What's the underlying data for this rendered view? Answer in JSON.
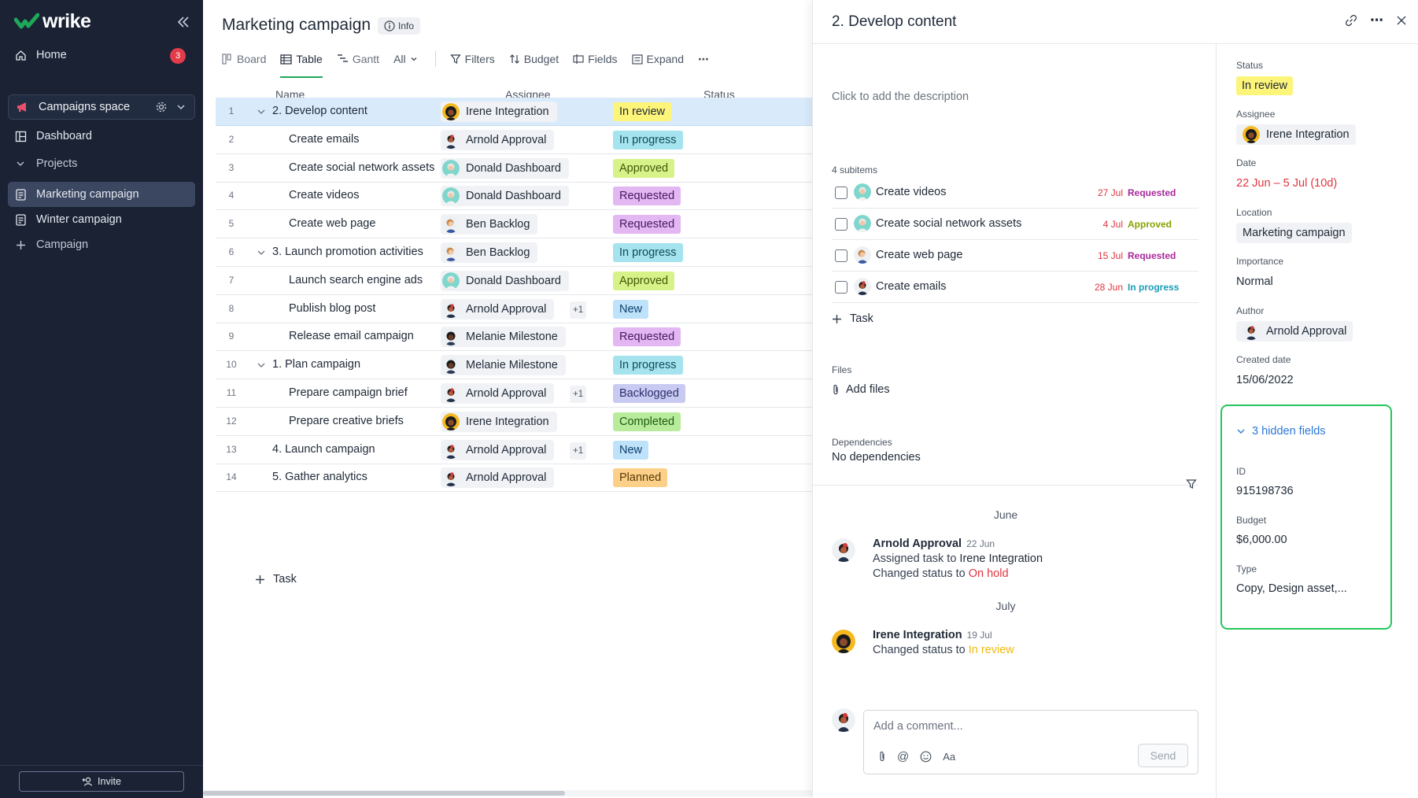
{
  "app": {
    "brand": "wrike",
    "home_label": "Home",
    "home_badge": "3",
    "space_label": "Campaigns space",
    "dashboard_label": "Dashboard",
    "projects_label": "Projects",
    "marketing_label": "Marketing campaign",
    "winter_label": "Winter campaign",
    "add_campaign_label": "Campaign",
    "invite_label": "Invite"
  },
  "colors": {
    "sidebar_bg": "#1a2234",
    "brand_green": "#1fa85a",
    "highlight_green": "#25c65a",
    "selected_row": "#d9ebfb"
  },
  "main": {
    "title": "Marketing campaign",
    "info_label": "Info",
    "toolbar": {
      "board": "Board",
      "table": "Table",
      "gantt": "Gantt",
      "all": "All",
      "filters": "Filters",
      "budget": "Budget",
      "fields": "Fields",
      "expand": "Expand"
    },
    "columns": {
      "name": "Name",
      "assignee": "Assignee",
      "status": "Status"
    },
    "rows": [
      {
        "num": "1",
        "name": "2. Develop content",
        "assignee": "Irene Integration",
        "status": "In review"
      },
      {
        "num": "2",
        "name": "Create emails",
        "assignee": "Arnold Approval",
        "status": "In progress"
      },
      {
        "num": "3",
        "name": "Create social network assets",
        "assignee": "Donald Dashboard",
        "status": "Approved"
      },
      {
        "num": "4",
        "name": "Create videos",
        "assignee": "Donald Dashboard",
        "status": "Requested"
      },
      {
        "num": "5",
        "name": "Create web page",
        "assignee": "Ben Backlog",
        "status": "Requested"
      },
      {
        "num": "6",
        "name": "3. Launch promotion activities",
        "assignee": "Ben Backlog",
        "status": "In progress"
      },
      {
        "num": "7",
        "name": "Launch search engine ads",
        "assignee": "Donald Dashboard",
        "status": "Approved"
      },
      {
        "num": "8",
        "name": "Publish blog post",
        "assignee": "Arnold Approval",
        "extra": "+1",
        "status": "New"
      },
      {
        "num": "9",
        "name": "Release email campaign",
        "assignee": "Melanie Milestone",
        "status": "Requested"
      },
      {
        "num": "10",
        "name": "1. Plan campaign",
        "assignee": "Melanie Milestone",
        "status": "In progress"
      },
      {
        "num": "11",
        "name": "Prepare campaign brief",
        "assignee": "Arnold Approval",
        "extra": "+1",
        "status": "Backlogged"
      },
      {
        "num": "12",
        "name": "Prepare creative briefs",
        "assignee": "Irene Integration",
        "status": "Completed"
      },
      {
        "num": "13",
        "name": "4. Launch campaign",
        "assignee": "Arnold Approval",
        "extra": "+1",
        "status": "New"
      },
      {
        "num": "14",
        "name": "5. Gather analytics",
        "assignee": "Arnold Approval",
        "status": "Planned"
      }
    ],
    "add_task_label": "Task"
  },
  "panel": {
    "title": "2. Develop content",
    "description_placeholder": "Click to add the description",
    "subitems_label": "4 subitems",
    "subitems": [
      {
        "name": "Create videos",
        "date": "27 Jul",
        "status": "Requested"
      },
      {
        "name": "Create social network assets",
        "date": "4 Jul",
        "status": "Approved"
      },
      {
        "name": "Create web page",
        "date": "15 Jul",
        "status": "Requested"
      },
      {
        "name": "Create emails",
        "date": "28 Jun",
        "status": "In progress"
      }
    ],
    "add_subtask_label": "Task",
    "files_label": "Files",
    "add_files_label": "Add files",
    "dependencies_label": "Dependencies",
    "dependencies_value": "No dependencies",
    "stream": {
      "month1": "June",
      "act1": {
        "author": "Arnold Approval",
        "time": "22 Jun",
        "line1_prefix": "Assigned task to ",
        "line1_target": "Irene Integration",
        "line2_prefix": "Changed status to ",
        "line2_status": "On hold"
      },
      "month2": "July",
      "act2": {
        "author": "Irene Integration",
        "time": "19 Jul",
        "line1_prefix": "Changed status to ",
        "line1_status": "In review"
      }
    },
    "comment": {
      "placeholder": "Add a comment...",
      "format_label": "Aa",
      "send_label": "Send"
    },
    "meta": {
      "status_label": "Status",
      "status_value": "In review",
      "assignee_label": "Assignee",
      "assignee_value": "Irene Integration",
      "date_label": "Date",
      "date_value": "22 Jun – 5 Jul (10d)",
      "location_label": "Location",
      "location_value": "Marketing campaign",
      "importance_label": "Importance",
      "importance_value": "Normal",
      "author_label": "Author",
      "author_value": "Arnold Approval",
      "created_label": "Created date",
      "created_value": "15/06/2022",
      "hidden_toggle": "3 hidden fields",
      "id_label": "ID",
      "id_value": "915198736",
      "budget_label": "Budget",
      "budget_value": "$6,000.00",
      "type_label": "Type",
      "type_value": "Copy, Design asset,..."
    }
  }
}
